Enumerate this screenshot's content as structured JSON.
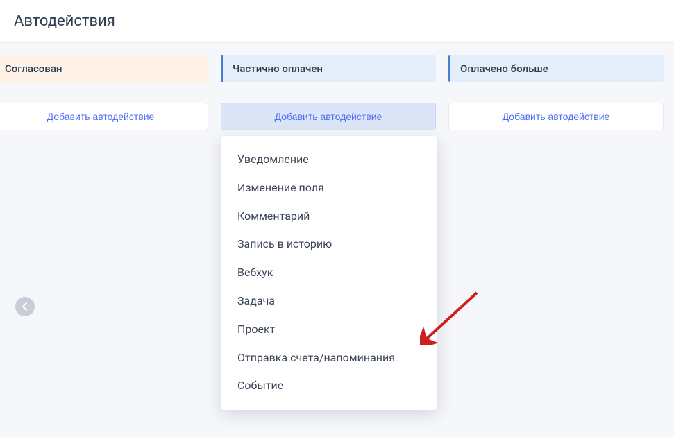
{
  "header": {
    "title": "Автодействия"
  },
  "columns": [
    {
      "label": "Согласован",
      "style": "peach",
      "add_label": "Добавить автодействие",
      "active": false
    },
    {
      "label": "Частично оплачен",
      "style": "blue",
      "add_label": "Добавить автодействие",
      "active": true
    },
    {
      "label": "Оплачено больше",
      "style": "blue",
      "add_label": "Добавить автодействие",
      "active": false
    }
  ],
  "dropdown": {
    "items": [
      "Уведомление",
      "Изменение поля",
      "Комментарий",
      "Запись в историю",
      "Вебхук",
      "Задача",
      "Проект",
      "Отправка счета/напоминания",
      "Событие"
    ]
  },
  "annotation": {
    "arrow_color": "#cc1f1f"
  }
}
